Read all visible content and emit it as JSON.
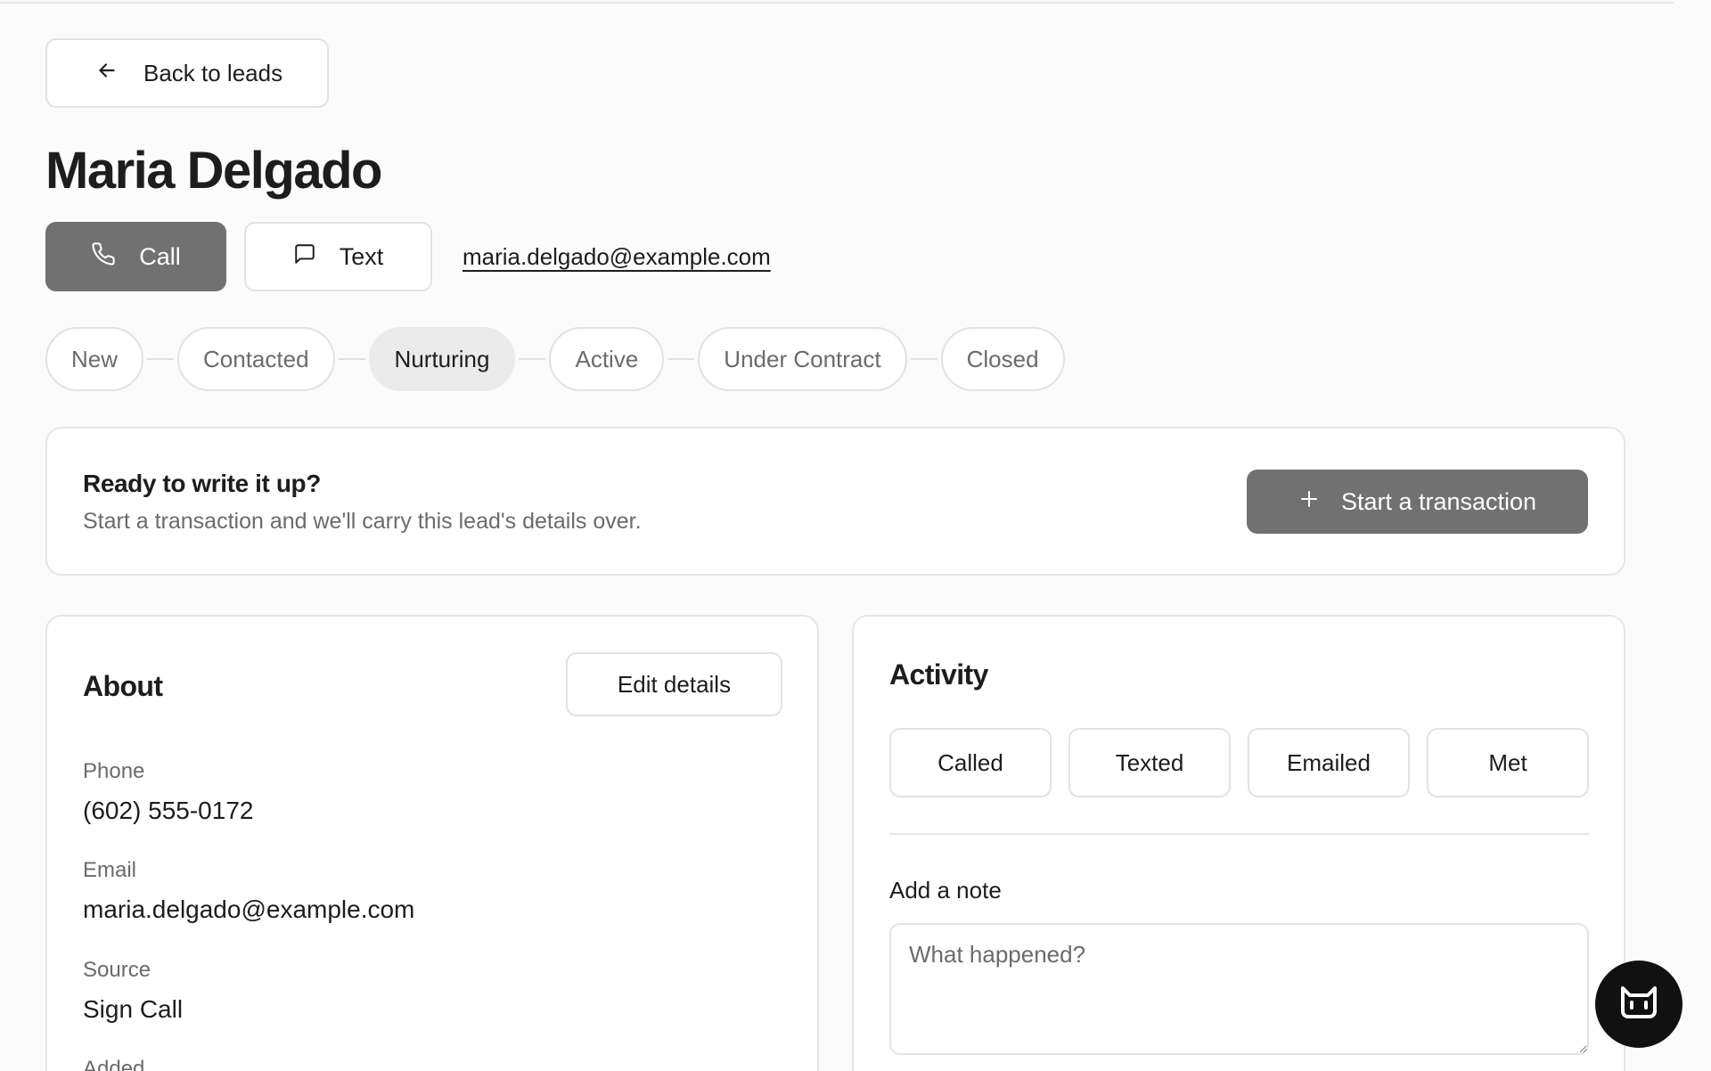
{
  "nav": {
    "back_label": "Back to leads"
  },
  "lead": {
    "name": "Maria Delgado"
  },
  "contact": {
    "call_label": "Call",
    "text_label": "Text",
    "email": "maria.delgado@example.com"
  },
  "pipeline": {
    "stages": [
      "New",
      "Contacted",
      "Nurturing",
      "Active",
      "Under Contract",
      "Closed"
    ],
    "current": "Nurturing"
  },
  "cta": {
    "title": "Ready to write it up?",
    "subtitle": "Start a transaction and we'll carry this lead's details over.",
    "button_label": "Start a transaction"
  },
  "about": {
    "title": "About",
    "edit_label": "Edit details",
    "fields": [
      {
        "label": "Phone",
        "value": "(602) 555-0172"
      },
      {
        "label": "Email",
        "value": "maria.delgado@example.com"
      },
      {
        "label": "Source",
        "value": "Sign Call"
      },
      {
        "label": "Added",
        "value": ""
      }
    ]
  },
  "activity": {
    "title": "Activity",
    "log_buttons": [
      "Called",
      "Texted",
      "Emailed",
      "Met"
    ],
    "note_label": "Add a note",
    "note_placeholder": "What happened?",
    "note_value": ""
  },
  "icons": {
    "back": "arrow-left-icon",
    "call": "phone-icon",
    "text": "message-square-icon",
    "cta": "plus-icon",
    "assistant": "bot-face-icon"
  },
  "colors": {
    "primary_button": "#717171",
    "active_stage": "#ebebeb",
    "fab": "#111111"
  }
}
